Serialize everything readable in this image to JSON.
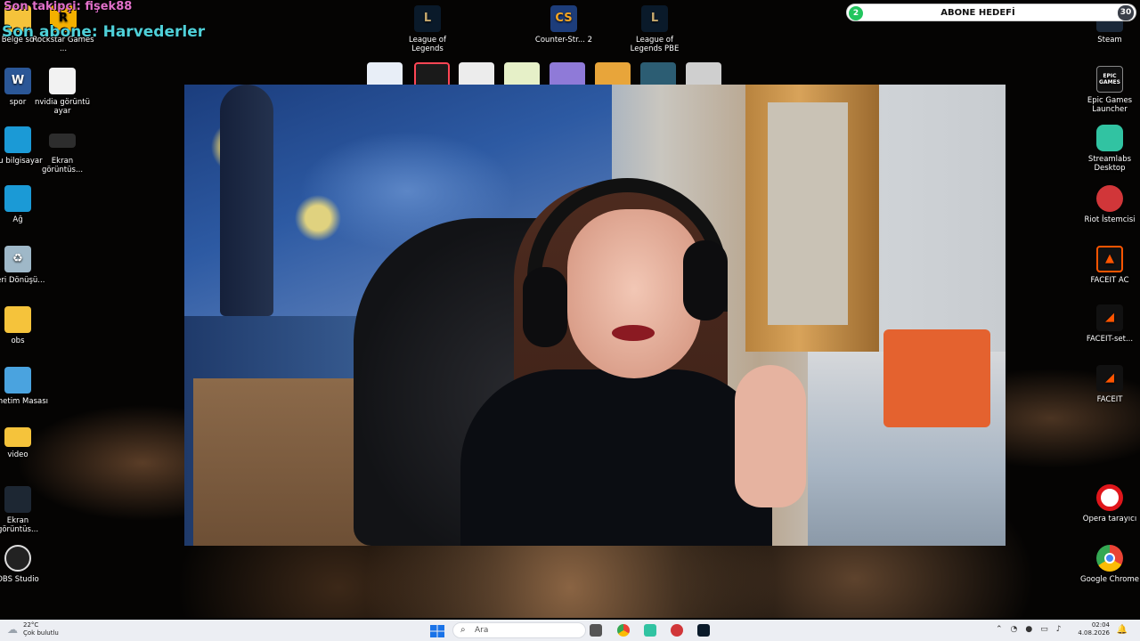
{
  "overlay": {
    "last_follower": "Son takipçi: fişek88",
    "last_subscriber": "Son abone: Harvederler"
  },
  "subscriber_goal": {
    "current": "2",
    "label": "ABONE HEDEFİ",
    "target": "30"
  },
  "desktop_left": [
    {
      "label": "Belge so",
      "icon": "folder-icon"
    },
    {
      "label": "Rockstar Games ...",
      "icon": "rockstar-icon"
    },
    {
      "label": "spor",
      "icon": "word-doc-icon"
    },
    {
      "label": "nvidia görüntü ayar",
      "icon": "document-icon"
    },
    {
      "label": "Bu bilgisayar",
      "icon": "computer-icon"
    },
    {
      "label": "Ekran görüntüs...",
      "icon": "screenshot-icon"
    },
    {
      "label": "Ağ",
      "icon": "network-icon"
    },
    {
      "label": "Geri Dönüşü...",
      "icon": "recycle-bin-icon"
    },
    {
      "label": "obs",
      "icon": "folder-icon"
    },
    {
      "label": "Denetim Masası",
      "icon": "control-panel-icon"
    },
    {
      "label": "video",
      "icon": "video-folder-icon"
    },
    {
      "label": "Ekran görüntüs...",
      "icon": "screenshot-icon"
    },
    {
      "label": "OBS Studio",
      "icon": "obs-icon"
    }
  ],
  "desktop_top": [
    {
      "label": "League of Legends",
      "icon": "league-icon"
    },
    {
      "label": "Counter-Str... 2",
      "icon": "counter-strike-icon"
    },
    {
      "label": "League of Legends PBE",
      "icon": "league-pbe-icon"
    }
  ],
  "desktop_right": [
    {
      "label": "Steam",
      "icon": "steam-icon"
    },
    {
      "label": "Epic Games Launcher",
      "icon": "epic-games-icon"
    },
    {
      "label": "Streamlabs Desktop",
      "icon": "streamlabs-icon"
    },
    {
      "label": "Riot İstemcisi",
      "icon": "riot-icon"
    },
    {
      "label": "FACEIT AC",
      "icon": "faceit-ac-icon"
    },
    {
      "label": "FACEIT-set...",
      "icon": "faceit-setup-icon"
    },
    {
      "label": "FACEIT",
      "icon": "faceit-icon"
    },
    {
      "label": "Opera tarayıcı",
      "icon": "opera-icon"
    },
    {
      "label": "Google Chrome",
      "icon": "chrome-icon"
    }
  ],
  "epic_logo_text": "EPIC GAMES",
  "taskbar": {
    "weather_temp": "22°C",
    "weather_desc": "Çok bulutlu",
    "search_placeholder": "Ara",
    "time": "02:04",
    "date": "4.08.2026"
  },
  "colors": {
    "goal_green": "#22c55e",
    "faceit_orange": "#ff5500",
    "streamlabs_teal": "#31c3a2",
    "riot_red": "#d13639"
  }
}
